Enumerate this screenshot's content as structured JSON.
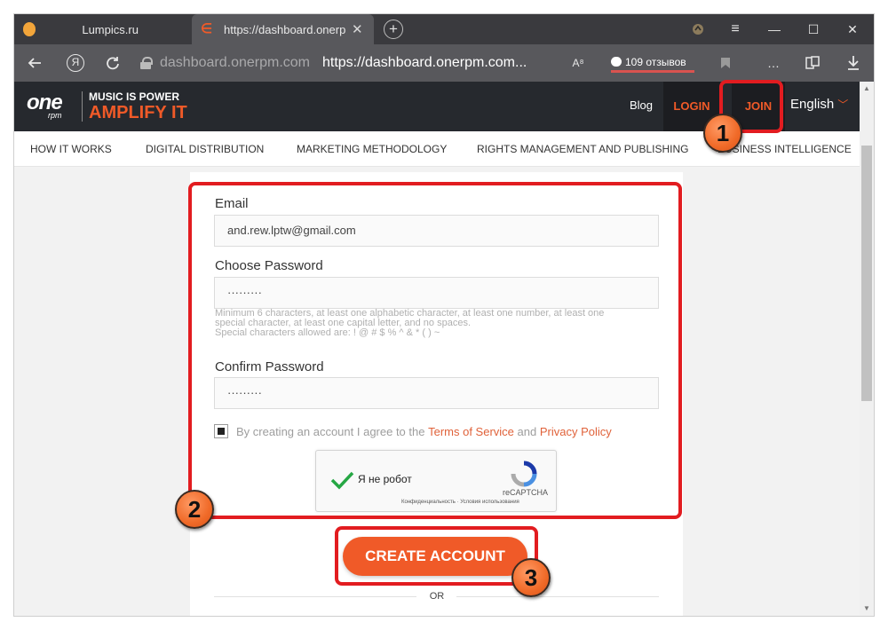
{
  "browser": {
    "tabs": [
      {
        "title": "Lumpics.ru"
      },
      {
        "title": "https://dashboard.onerpm",
        "close": "✕"
      }
    ],
    "new_tab": "+",
    "window_controls": {
      "minimize": "—",
      "maximize": "☐",
      "close": "✕",
      "menu": "≡"
    },
    "address": {
      "domain": "dashboard.onerpm.com",
      "url": "https://dashboard.onerpm.com...",
      "reviews": "109 отзывов"
    }
  },
  "site": {
    "logo": {
      "one": "one",
      "rpm": "rpm"
    },
    "tagline_top": "MUSIC IS POWER",
    "tagline_bottom": "AMPLIFY IT",
    "nav": {
      "blog": "Blog",
      "login": "LOGIN",
      "join": "JOIN",
      "language": "English"
    },
    "menu": [
      "HOW IT WORKS",
      "DIGITAL DISTRIBUTION",
      "MARKETING METHODOLOGY",
      "RIGHTS MANAGEMENT AND PUBLISHING",
      "BUSINESS INTELLIGENCE"
    ]
  },
  "form": {
    "email_label": "Email",
    "email_value": "and.rew.lptw@gmail.com",
    "password_label": "Choose Password",
    "password_value": "·········",
    "password_hint": [
      "Minimum 6 characters, at least one alphabetic character, at least one number, at least one",
      "special character, at least one capital letter, and no spaces.",
      "Special characters allowed are: ! @ # $ % ^ & * ( ) ~"
    ],
    "confirm_label": "Confirm Password",
    "confirm_value": "·········",
    "terms_prefix": "By creating an account I agree to the",
    "terms_link": "Terms of Service",
    "terms_and": "and",
    "privacy_link": "Privacy Policy",
    "recaptcha": {
      "label": "Я не робот",
      "brand": "reCAPTCHA",
      "links": "Конфиденциальность · Условия использования"
    },
    "create_button": "CREATE ACCOUNT",
    "or_text": "OR"
  },
  "annotations": {
    "badge1": "1",
    "badge2": "2",
    "badge3": "3",
    "color": "#e21c20"
  },
  "colors": {
    "accent": "#f05a28",
    "header_bg": "#26292e",
    "tab_bar": "#3a3a3e"
  },
  "icons": [
    "back-arrow-icon",
    "yandex-icon",
    "reload-icon",
    "lock-icon",
    "translate-icon",
    "bookmark-icon",
    "more-icon",
    "collections-icon",
    "download-icon",
    "shield-icon",
    "chevron-down-icon",
    "recaptcha-logo-icon",
    "checkmark-icon"
  ]
}
